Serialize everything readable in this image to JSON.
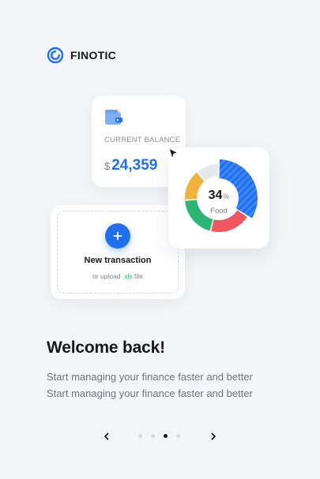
{
  "brand": {
    "name": "FINOTIC",
    "logo_icon": "swirl-logo-icon"
  },
  "balance_card": {
    "icon": "wallet-icon",
    "label": "CURRENT BALANCE",
    "currency": "$",
    "amount": "24,359"
  },
  "transaction_card": {
    "icon": "plus-icon",
    "title": "New transaction",
    "subtitle_prefix": "or upload ",
    "subtitle_ext": ".xls",
    "subtitle_suffix": " file"
  },
  "chart_data": {
    "type": "pie",
    "variant": "donut",
    "center_value": "34",
    "center_unit": "%",
    "center_label": "Food",
    "slices": [
      {
        "label": "Food",
        "percent": 34,
        "color": "#1f6ff0",
        "highlighted": true
      },
      {
        "percent": 20,
        "color": "#f0565e"
      },
      {
        "percent": 20,
        "color": "#2bb673"
      },
      {
        "percent": 15,
        "color": "#f2b33d"
      },
      {
        "percent": 11,
        "color": "#e6e8ee"
      }
    ]
  },
  "welcome": {
    "title": "Welcome back!",
    "line1": "Start managing your finance faster and better",
    "line2": "Start managing your finance faster and better"
  },
  "pager": {
    "prev_icon": "chevron-left-icon",
    "next_icon": "chevron-right-icon",
    "pages": 4,
    "active_index": 2
  },
  "colors": {
    "accent": "#1f6ff0",
    "text": "#17171c",
    "muted": "#6f7380",
    "background": "#f4f5f8"
  }
}
